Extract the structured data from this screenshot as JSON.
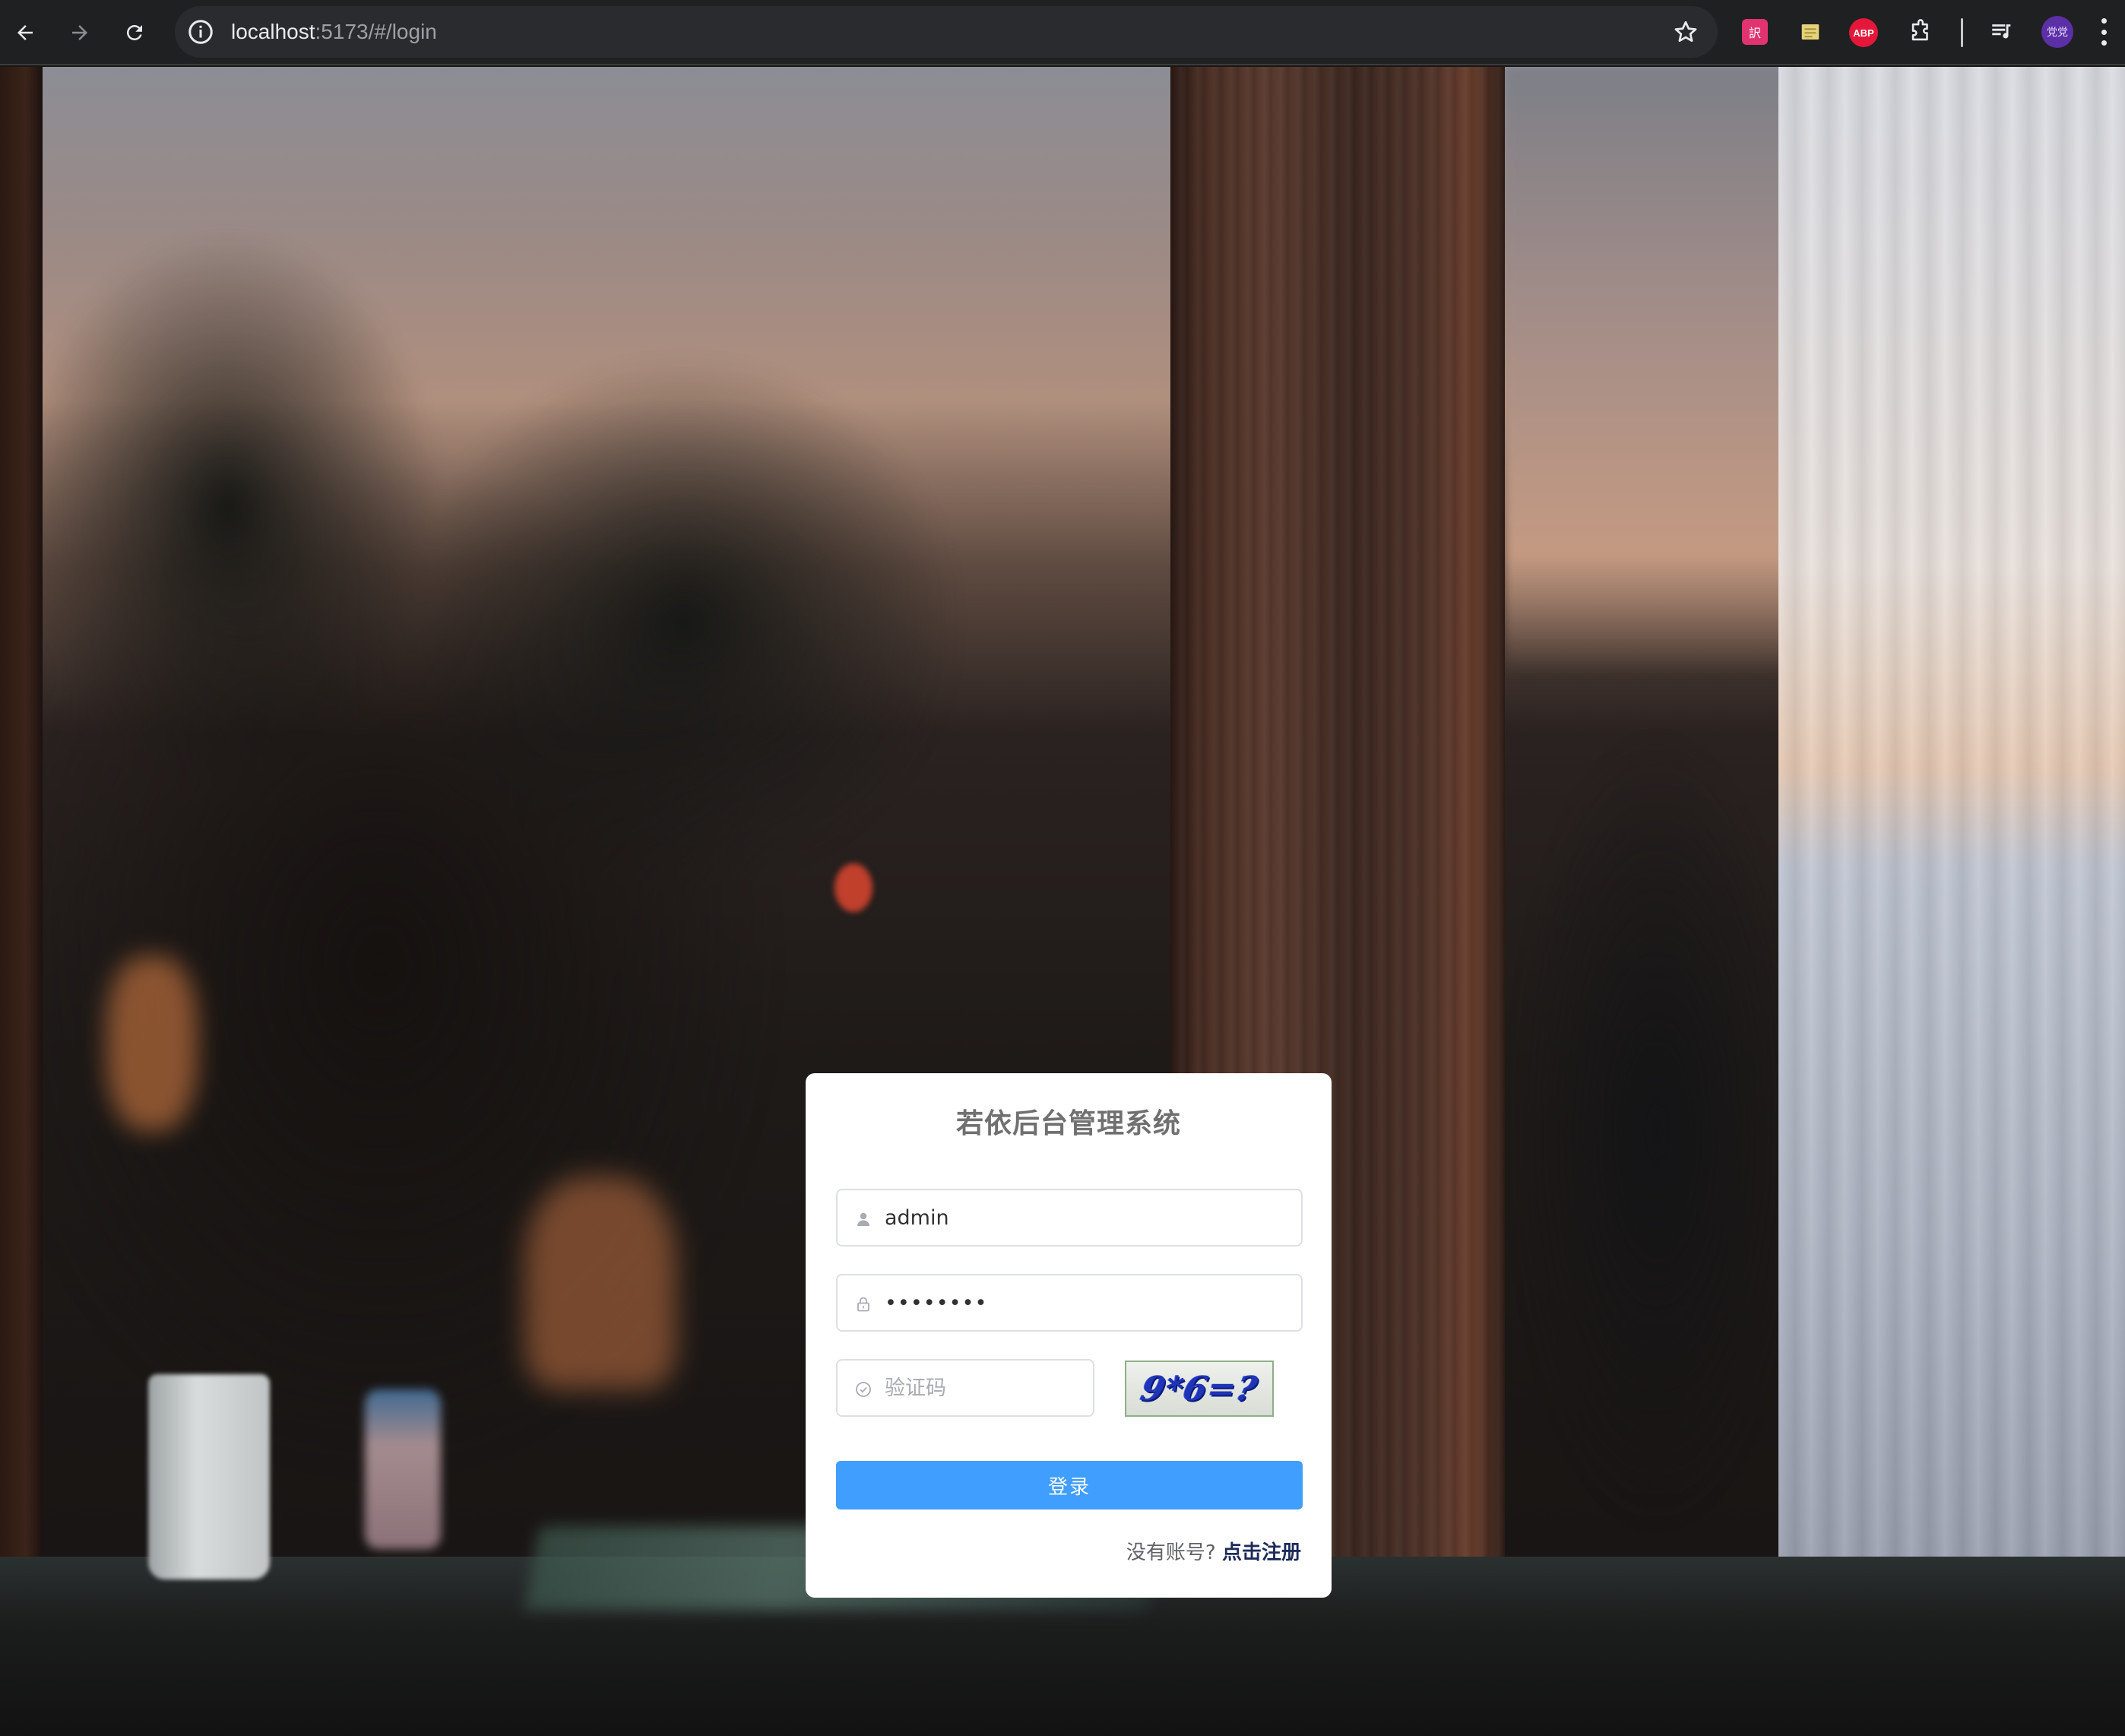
{
  "browser": {
    "url_host": "localhost",
    "url_path": ":5173/#/login",
    "extensions": [
      "translate-extension",
      "sticky-notes-extension",
      "adblock-plus-extension",
      "extensions-puzzle"
    ],
    "abp_label": "ABP",
    "translate_label": "訳",
    "avatar_label": "党党"
  },
  "login": {
    "title": "若依后台管理系统",
    "username_value": "admin",
    "password_value": "••••••••",
    "code_placeholder": "验证码",
    "captcha_text": "9*6=?",
    "submit_label": "登录",
    "register_prompt": "没有账号?",
    "register_link": "点击注册"
  },
  "colors": {
    "primary": "#409eff",
    "link": "#1d2b5a",
    "title": "#707070"
  }
}
